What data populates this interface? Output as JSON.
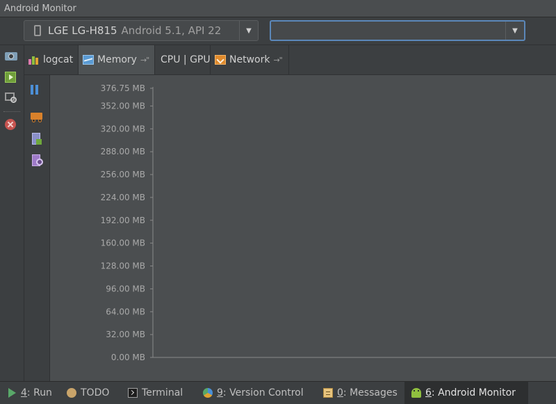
{
  "window": {
    "title": "Android Monitor"
  },
  "device_selector": {
    "device": "LGE LG-H815",
    "api": "Android 5.1, API 22"
  },
  "process_selector": {
    "value": ""
  },
  "left_toolbar": {
    "icons": [
      "camera-icon",
      "screen-record-icon",
      "system-info-icon",
      "terminate-icon"
    ]
  },
  "tabs": [
    {
      "label": "logcat",
      "icon": "logcat-icon",
      "active": false
    },
    {
      "label": "Memory",
      "icon": "memory-icon",
      "active": true,
      "pin": "→\""
    },
    {
      "label": "CPU | GPU",
      "icon": "",
      "active": false
    },
    {
      "label": "Network",
      "icon": "network-icon",
      "active": false,
      "pin": "→\""
    }
  ],
  "memory_tools": {
    "icons": [
      "pause-icon",
      "garbage-collect-icon",
      "dump-heap-icon",
      "allocation-tracker-icon"
    ]
  },
  "chart_data": {
    "type": "line",
    "title": "",
    "xlabel": "",
    "ylabel": "",
    "yticks": [
      {
        "value": 376.75,
        "label": "376.75 MB"
      },
      {
        "value": 352,
        "label": "352.00 MB"
      },
      {
        "value": 320,
        "label": "320.00 MB"
      },
      {
        "value": 288,
        "label": "288.00 MB"
      },
      {
        "value": 256,
        "label": "256.00 MB"
      },
      {
        "value": 224,
        "label": "224.00 MB"
      },
      {
        "value": 192,
        "label": "192.00 MB"
      },
      {
        "value": 160,
        "label": "160.00 MB"
      },
      {
        "value": 128,
        "label": "128.00 MB"
      },
      {
        "value": 96,
        "label": "96.00 MB"
      },
      {
        "value": 64,
        "label": "64.00 MB"
      },
      {
        "value": 32,
        "label": "32.00 MB"
      },
      {
        "value": 0,
        "label": "0.00 MB"
      }
    ],
    "ylim": [
      0,
      376.75
    ],
    "series": [],
    "grid": false
  },
  "statusbar": {
    "items": [
      {
        "key": "4",
        "label": ": Run",
        "icon": "run-icon"
      },
      {
        "key": "",
        "label": "TODO",
        "icon": "todo-icon"
      },
      {
        "key": "",
        "label": "Terminal",
        "icon": "terminal-icon"
      },
      {
        "key": "9",
        "label": ": Version Control",
        "icon": "vcs-icon"
      },
      {
        "key": "0",
        "label": ": Messages",
        "icon": "messages-icon"
      },
      {
        "key": "6",
        "label": ": Android Monitor",
        "icon": "android-icon",
        "active": true
      }
    ]
  }
}
